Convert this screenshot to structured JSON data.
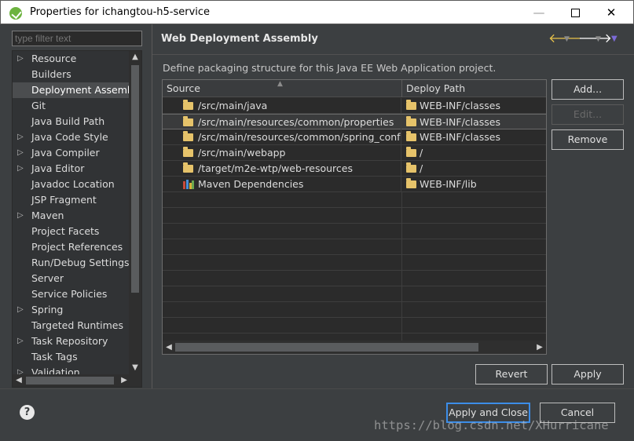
{
  "window": {
    "title": "Properties for ichangtou-h5-service",
    "minimize": "—",
    "close": "✕"
  },
  "sidebar": {
    "filter_placeholder": "type filter text",
    "items": [
      {
        "label": "Resource",
        "expandable": true
      },
      {
        "label": "Builders",
        "expandable": false
      },
      {
        "label": "Deployment Assembly",
        "expandable": false,
        "selected": true
      },
      {
        "label": "Git",
        "expandable": false
      },
      {
        "label": "Java Build Path",
        "expandable": false
      },
      {
        "label": "Java Code Style",
        "expandable": true
      },
      {
        "label": "Java Compiler",
        "expandable": true
      },
      {
        "label": "Java Editor",
        "expandable": true
      },
      {
        "label": "Javadoc Location",
        "expandable": false
      },
      {
        "label": "JSP Fragment",
        "expandable": false
      },
      {
        "label": "Maven",
        "expandable": true
      },
      {
        "label": "Project Facets",
        "expandable": false
      },
      {
        "label": "Project References",
        "expandable": false
      },
      {
        "label": "Run/Debug Settings",
        "expandable": false
      },
      {
        "label": "Server",
        "expandable": false
      },
      {
        "label": "Service Policies",
        "expandable": false
      },
      {
        "label": "Spring",
        "expandable": true
      },
      {
        "label": "Targeted Runtimes",
        "expandable": false
      },
      {
        "label": "Task Repository",
        "expandable": true
      },
      {
        "label": "Task Tags",
        "expandable": false
      },
      {
        "label": "Validation",
        "expandable": true
      }
    ]
  },
  "page": {
    "title": "Web Deployment Assembly",
    "description": "Define packaging structure for this Java EE Web Application project."
  },
  "table": {
    "columns": [
      "Source",
      "Deploy Path"
    ],
    "rows": [
      {
        "source": "/src/main/java",
        "deploy": "WEB-INF/classes",
        "icon": "folder-icon"
      },
      {
        "source": "/src/main/resources/common/properties",
        "deploy": "WEB-INF/classes",
        "icon": "folder-icon",
        "selected": true
      },
      {
        "source": "/src/main/resources/common/spring_conf",
        "deploy": "WEB-INF/classes",
        "icon": "folder-icon"
      },
      {
        "source": "/src/main/webapp",
        "deploy": "/",
        "icon": "folder-icon"
      },
      {
        "source": "/target/m2e-wtp/web-resources",
        "deploy": "/",
        "icon": "folder-icon"
      },
      {
        "source": "Maven Dependencies",
        "deploy": "WEB-INF/lib",
        "icon": "library-icon"
      }
    ]
  },
  "buttons": {
    "add": "Add...",
    "edit": "Edit...",
    "remove": "Remove",
    "revert": "Revert",
    "apply": "Apply",
    "apply_close": "Apply and Close",
    "cancel": "Cancel"
  },
  "help_label": "?",
  "watermark": "https://blog.csdn.net/XHurricane"
}
